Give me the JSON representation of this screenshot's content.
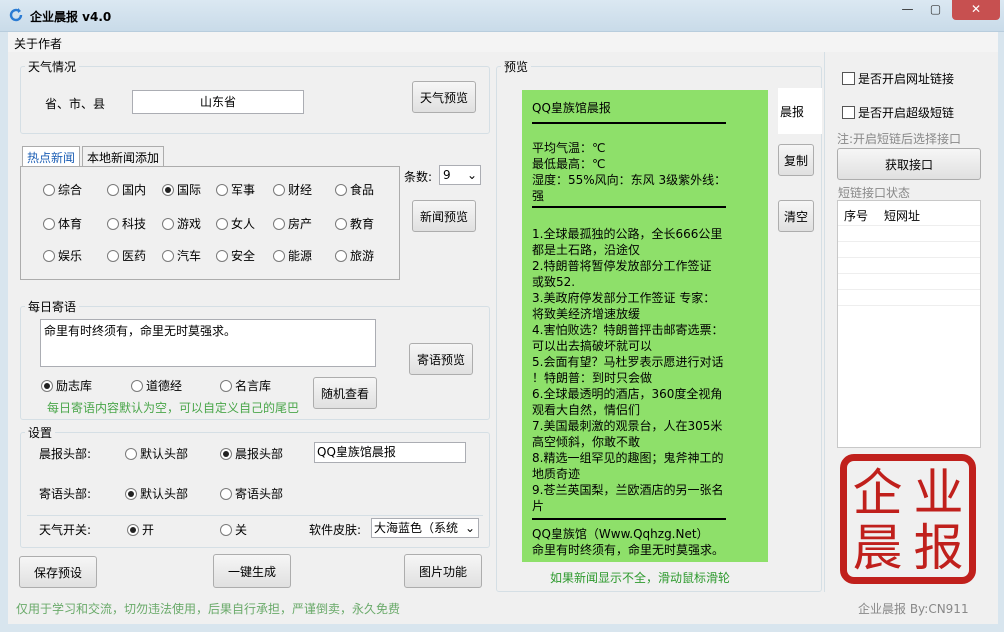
{
  "window": {
    "title": "企业晨报 v4.0",
    "min": "—",
    "max": "▢",
    "close": "✕"
  },
  "menu": {
    "about": "关于作者"
  },
  "weather": {
    "legend": "天气情况",
    "region_label": "省、市、县",
    "region_value": "山东省",
    "preview_btn": "天气预览"
  },
  "news": {
    "tabs": [
      "热点新闻",
      "本地新闻添加"
    ],
    "categories": [
      [
        "综合",
        "国内",
        "国际",
        "军事",
        "财经",
        "食品"
      ],
      [
        "体育",
        "科技",
        "游戏",
        "女人",
        "房产",
        "教育"
      ],
      [
        "娱乐",
        "医药",
        "汽车",
        "安全",
        "能源",
        "旅游"
      ]
    ],
    "selected": "国际",
    "count_label": "条数:",
    "count_value": "9",
    "preview_btn": "新闻预览"
  },
  "daily": {
    "legend": "每日寄语",
    "text": "命里有时终须有，命里无时莫强求。",
    "options": [
      "励志库",
      "道德经",
      "名言库"
    ],
    "selected": "励志库",
    "random_btn": "随机查看",
    "preview_btn": "寄语预览",
    "hint": "每日寄语内容默认为空，可以自定义自己的尾巴"
  },
  "settings": {
    "legend": "设置",
    "header_label": "晨报头部:",
    "header_options": [
      "默认头部",
      "晨报头部"
    ],
    "header_selected": "晨报头部",
    "header_value": "QQ皇族馆晨报",
    "tail_label": "寄语头部:",
    "tail_options": [
      "默认头部",
      "寄语头部"
    ],
    "tail_selected": "默认头部",
    "weather_switch_label": "天气开关:",
    "weather_options": [
      "开",
      "关"
    ],
    "weather_selected": "开",
    "skin_label": "软件皮肤:",
    "skin_value": "大海蓝色（系统"
  },
  "actions": {
    "save": "保存预设",
    "generate": "一键生成",
    "image": "图片功能"
  },
  "preview": {
    "legend": "预览",
    "side_buttons": [
      "晨报",
      "复制",
      "清空"
    ],
    "footer_hint": "如果新闻显示不全，滑动鼠标滑轮",
    "lines": {
      "title": "QQ皇族馆晨报",
      "temp1": "平均气温：℃",
      "temp2": "最低最高：℃",
      "humidity": "湿度：55%风向：东风 3级紫外线：",
      "uv": "强",
      "news": [
        "1.全球最孤独的公路，全长666公里",
        "都是土石路，沿途仅",
        "2.特朗普将暂停发放部分工作签证",
        "或致52.",
        "3.美政府停发部分工作签证 专家：",
        "将致美经济增速放缓",
        "4.害怕败选？特朗普抨击邮寄选票：",
        "可以出去搞破坏就可以",
        "5.会面有望？马杜罗表示愿进行对话",
        "！特朗普：到时只会做",
        "6.全球最透明的酒店，360度全视角",
        "观看大自然，情侣们",
        "7.美国最刺激的观景台，人在305米",
        "高空倾斜，你敢不敢",
        "8.精选一组罕见的趣图；鬼斧神工的",
        "地质奇迹",
        "9.苍兰英国梨，兰欧酒店的另一张名",
        "片"
      ],
      "signature": "QQ皇族馆（Www.Qqhzg.Net）",
      "motto": "命里有时终须有，命里无时莫强求。"
    }
  },
  "shortlink": {
    "opt1": "是否开启网址链接",
    "opt2": "是否开启超级短链",
    "note": "注:开启短链后选择接口",
    "get_btn": "获取接口",
    "status_label": "短链接口状态",
    "col1": "序号",
    "col2": "短网址",
    "seal_chars": [
      "企",
      "业",
      "晨",
      "报"
    ]
  },
  "status": {
    "left": "仅用于学习和交流，切勿违法使用，后果自行承担，严谨倒卖，永久免费",
    "right": "企业晨报 By:CN911"
  }
}
